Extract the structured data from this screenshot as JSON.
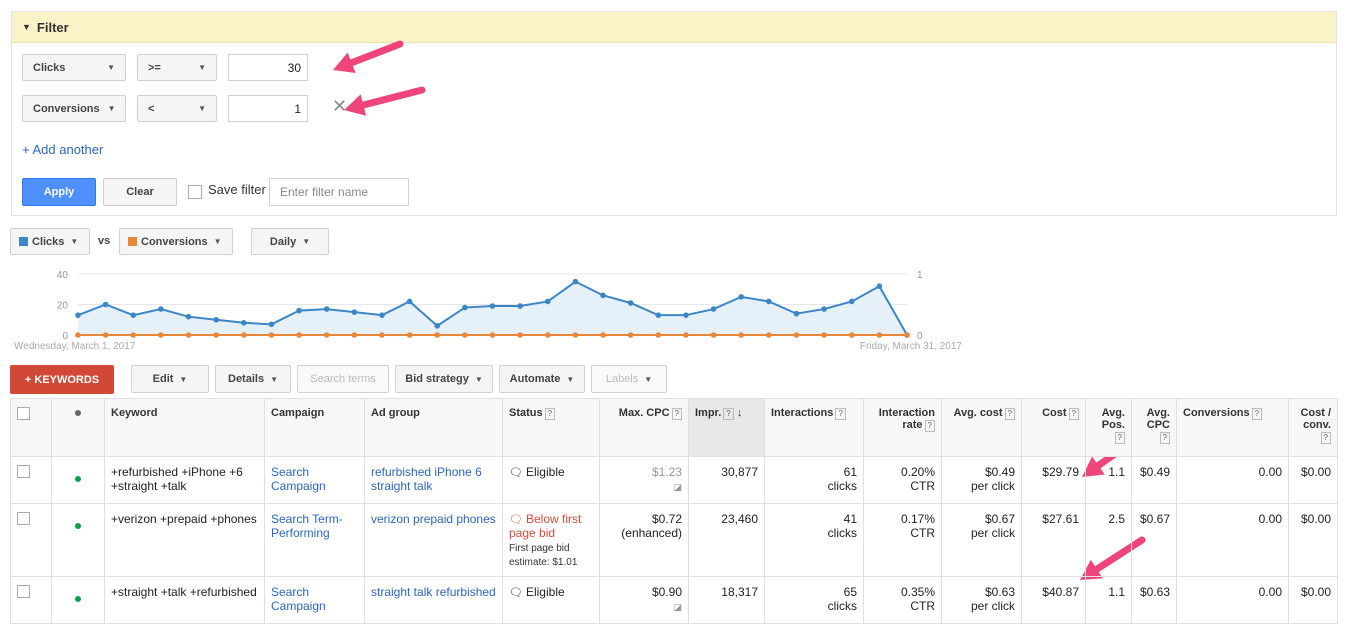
{
  "filter": {
    "title": "Filter",
    "rows": [
      {
        "metric": "Clicks",
        "operator": ">=",
        "value": "30"
      },
      {
        "metric": "Conversions",
        "operator": "<",
        "value": "1"
      }
    ],
    "add_another": "+ Add another",
    "apply": "Apply",
    "clear": "Clear",
    "save_filter": "Save filter",
    "filter_name_placeholder": "Enter filter name"
  },
  "chart_controls": {
    "metric1": "Clicks",
    "vs": "vs",
    "metric2": "Conversions",
    "interval": "Daily",
    "metric1_color": "#3b86c6",
    "metric2_color": "#e8863a"
  },
  "chart_data": {
    "type": "line",
    "x_start_label": "Wednesday, March 1, 2017",
    "x_end_label": "Friday, March 31, 2017",
    "series": [
      {
        "name": "Clicks",
        "axis": "left",
        "values": [
          13,
          20,
          13,
          17,
          12,
          10,
          8,
          7,
          16,
          17,
          15,
          13,
          22,
          6,
          18,
          19,
          19,
          22,
          35,
          26,
          21,
          13,
          13,
          17,
          25,
          22,
          14,
          17,
          22,
          32,
          0
        ]
      },
      {
        "name": "Conversions",
        "axis": "right",
        "values": [
          0,
          0,
          0,
          0,
          0,
          0,
          0,
          0,
          0,
          0,
          0,
          0,
          0,
          0,
          0,
          0,
          0,
          0,
          0,
          0,
          0,
          0,
          0,
          0,
          0,
          0,
          0,
          0,
          0,
          0,
          0
        ]
      }
    ],
    "left_ticks": [
      "0",
      "20",
      "40"
    ],
    "right_ticks": [
      "0",
      "1"
    ],
    "ylim_left": [
      0,
      40
    ],
    "ylim_right": [
      0,
      1
    ],
    "grid": true
  },
  "toolbar": {
    "keywords": "+ KEYWORDS",
    "edit": "Edit",
    "details": "Details",
    "search_terms": "Search terms",
    "bid_strategy": "Bid strategy",
    "automate": "Automate",
    "labels": "Labels"
  },
  "table": {
    "headers": {
      "keyword": "Keyword",
      "campaign": "Campaign",
      "ad_group": "Ad group",
      "status": "Status",
      "max_cpc": "Max. CPC",
      "impr": "Impr.",
      "interactions": "Interactions",
      "interaction_rate": "Interaction rate",
      "avg_cost": "Avg. cost",
      "cost": "Cost",
      "avg_pos": "Avg. Pos.",
      "avg_cpc": "Avg. CPC",
      "conversions": "Conversions",
      "cost_conv": "Cost / conv.",
      "help": "?"
    },
    "rows": [
      {
        "keyword": "+refurbished +iPhone +6 +straight +talk",
        "campaign": "Search Campaign",
        "ad_group": "refurbished iPhone 6 straight talk",
        "status": "Eligible",
        "max_cpc": "$1.23",
        "impr": "30,877",
        "interactions": "61",
        "interactions_unit": "clicks",
        "rate": "0.20%",
        "rate_unit": "CTR",
        "avg_cost": "$0.49",
        "avg_cost_unit": "per click",
        "cost": "$29.79",
        "avg_pos": "1.1",
        "avg_cpc": "$0.49",
        "conversions": "0.00",
        "cost_conv": "$0.00"
      },
      {
        "keyword": "+verizon +prepaid +phones",
        "campaign": "Search Term-Performing",
        "ad_group": "verizon prepaid phones",
        "status": "Below first page bid",
        "status_note": "First page bid estimate: $1.01",
        "max_cpc": "$0.72",
        "max_cpc_note": "(enhanced)",
        "impr": "23,460",
        "interactions": "41",
        "interactions_unit": "clicks",
        "rate": "0.17%",
        "rate_unit": "CTR",
        "avg_cost": "$0.67",
        "avg_cost_unit": "per click",
        "cost": "$27.61",
        "avg_pos": "2.5",
        "avg_cpc": "$0.67",
        "conversions": "0.00",
        "cost_conv": "$0.00"
      },
      {
        "keyword": "+straight +talk +refurbished",
        "campaign": "Search Campaign",
        "ad_group": "straight talk refurbished",
        "status": "Eligible",
        "max_cpc": "$0.90",
        "impr": "18,317",
        "interactions": "65",
        "interactions_unit": "clicks",
        "rate": "0.35%",
        "rate_unit": "CTR",
        "avg_cost": "$0.63",
        "avg_cost_unit": "per click",
        "cost": "$40.87",
        "avg_pos": "1.1",
        "avg_cpc": "$0.63",
        "conversions": "0.00",
        "cost_conv": "$0.00"
      }
    ]
  },
  "annotation_color": "#f0457a"
}
